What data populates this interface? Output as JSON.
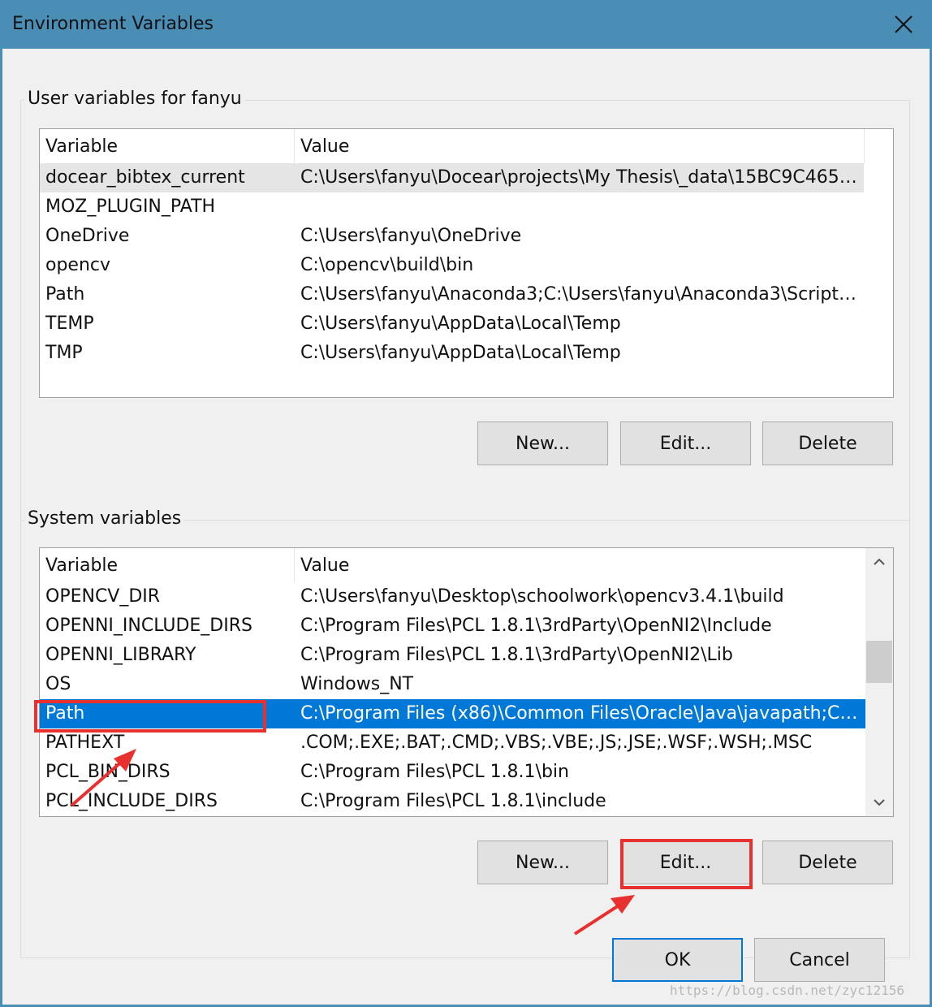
{
  "window": {
    "title": "Environment Variables",
    "close_icon": "close-icon"
  },
  "user_vars": {
    "group_label": "User variables for fanyu",
    "columns": [
      "Variable",
      "Value"
    ],
    "rows": [
      {
        "variable": "docear_bibtex_current",
        "value": "C:\\Users\\fanyu\\Docear\\projects\\My Thesis\\_data\\15BC9C46523..."
      },
      {
        "variable": "MOZ_PLUGIN_PATH",
        "value": ""
      },
      {
        "variable": "OneDrive",
        "value": "C:\\Users\\fanyu\\OneDrive"
      },
      {
        "variable": "opencv",
        "value": "C:\\opencv\\build\\bin"
      },
      {
        "variable": "Path",
        "value": "C:\\Users\\fanyu\\Anaconda3;C:\\Users\\fanyu\\Anaconda3\\Scripts;C..."
      },
      {
        "variable": "TEMP",
        "value": "C:\\Users\\fanyu\\AppData\\Local\\Temp"
      },
      {
        "variable": "TMP",
        "value": "C:\\Users\\fanyu\\AppData\\Local\\Temp"
      }
    ],
    "buttons": {
      "new": "New...",
      "edit": "Edit...",
      "delete": "Delete"
    }
  },
  "system_vars": {
    "group_label": "System variables",
    "columns": [
      "Variable",
      "Value"
    ],
    "rows": [
      {
        "variable": "OPENCV_DIR",
        "value": "C:\\Users\\fanyu\\Desktop\\schoolwork\\opencv3.4.1\\build"
      },
      {
        "variable": "OPENNI_INCLUDE_DIRS",
        "value": "C:\\Program Files\\PCL 1.8.1\\3rdParty\\OpenNI2\\Include"
      },
      {
        "variable": "OPENNI_LIBRARY",
        "value": "C:\\Program Files\\PCL 1.8.1\\3rdParty\\OpenNI2\\Lib"
      },
      {
        "variable": "OS",
        "value": "Windows_NT"
      },
      {
        "variable": "Path",
        "value": "C:\\Program Files (x86)\\Common Files\\Oracle\\Java\\javapath;C:\\P..."
      },
      {
        "variable": "PATHEXT",
        "value": ".COM;.EXE;.BAT;.CMD;.VBS;.VBE;.JS;.JSE;.WSF;.WSH;.MSC"
      },
      {
        "variable": "PCL_BIN_DIRS",
        "value": "C:\\Program Files\\PCL 1.8.1\\bin"
      },
      {
        "variable": "PCL_INCLUDE_DIRS",
        "value": "C:\\Program Files\\PCL 1.8.1\\include"
      }
    ],
    "selected_row": "Path",
    "buttons": {
      "new": "New...",
      "edit": "Edit...",
      "delete": "Delete"
    }
  },
  "dialog_buttons": {
    "ok": "OK",
    "cancel": "Cancel"
  },
  "watermark": "https://blog.csdn.net/zyc12156",
  "colors": {
    "titlebar": "#4a8db5",
    "selection": "#0078d7",
    "annotation": "#e8312f"
  }
}
